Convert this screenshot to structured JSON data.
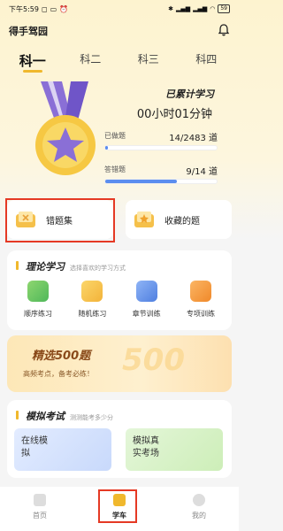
{
  "status_bar": {
    "time": "下午5:59",
    "battery": "59"
  },
  "app": {
    "title": "得手驾园"
  },
  "tabs": [
    "科一",
    "科二",
    "科三",
    "科四"
  ],
  "hero": {
    "heading": "已累计学习",
    "duration": "00小时01分钟",
    "done_label": "已做题",
    "done_value": "14/2483 道",
    "done_progress": 0.006,
    "correct_label": "答错题",
    "correct_value": "9/14 道",
    "correct_progress": 0.64
  },
  "quick": {
    "wrong_label": "错题集",
    "fav_label": "收藏的题"
  },
  "theory": {
    "title": "理论学习",
    "subtitle": "选择喜欢的学习方式",
    "items": [
      "顺序练习",
      "随机练习",
      "章节训练",
      "专项训练"
    ]
  },
  "banner": {
    "title": "精选500题",
    "subtitle": "高频考点，备考必练！",
    "bg_text": "500"
  },
  "exam": {
    "title": "模拟考试",
    "subtitle": "测测能考多少分",
    "card1": "在线模\n拟",
    "card2": "模拟真\n实考场"
  },
  "nav": {
    "home": "首页",
    "study": "学车",
    "mine": "我的"
  },
  "colors": {
    "accent": "#f0b82d",
    "progress_blue": "#5b8def",
    "highlight_red": "#e53924"
  }
}
